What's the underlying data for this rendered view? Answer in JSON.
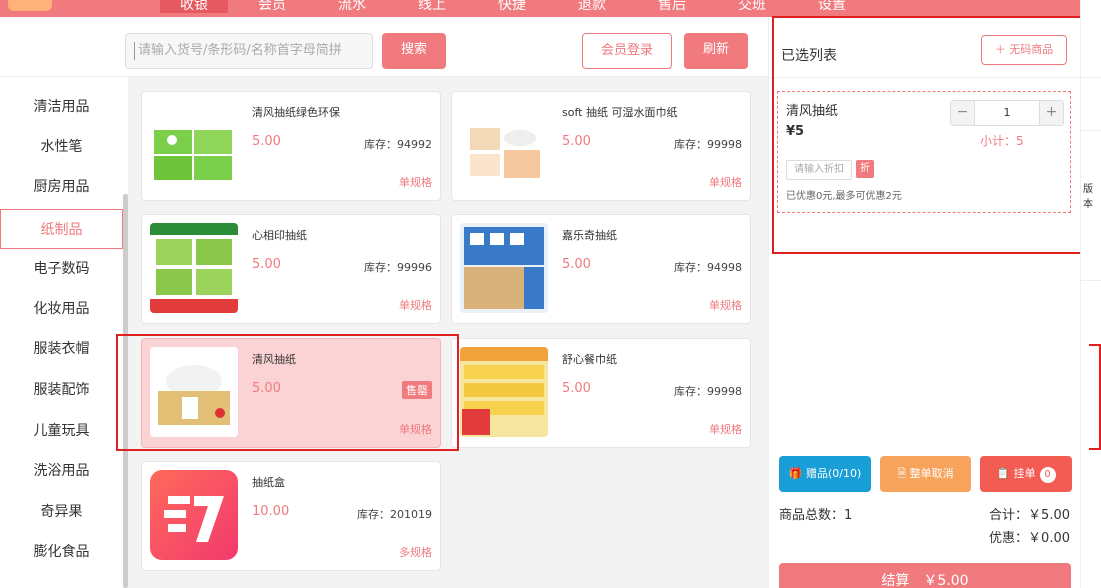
{
  "nav": {
    "tabs": [
      "收银",
      "会员",
      "流水",
      "线上",
      "快捷",
      "退款",
      "售后",
      "交班",
      "设置"
    ],
    "active_index": 0
  },
  "search": {
    "placeholder": "请输入货号/条形码/名称首字母简拼",
    "search_label": "搜索",
    "member_login_label": "会员登录",
    "refresh_label": "刷新"
  },
  "categories": [
    "清洁用品",
    "水性笔",
    "厨房用品",
    "纸制品",
    "电子数码",
    "化妆用品",
    "服装衣帽",
    "服装配饰",
    "儿童玩具",
    "洗浴用品",
    "奇异果",
    "膨化食品"
  ],
  "active_category_index": 3,
  "products": [
    {
      "name": "清风抽纸绿色环保",
      "price": "5.00",
      "stock": "库存：94992",
      "spec": "单规格"
    },
    {
      "name": "soft 抽纸 可湿水面巾纸",
      "price": "5.00",
      "stock": "库存：99998",
      "spec": "单规格"
    },
    {
      "name": "心相印抽纸",
      "price": "5.00",
      "stock": "库存：99996",
      "spec": "单规格"
    },
    {
      "name": "嘉乐奇抽纸",
      "price": "5.00",
      "stock": "库存：94998",
      "spec": "单规格"
    },
    {
      "name": "清风抽纸",
      "price": "5.00",
      "badge": "售罄",
      "spec": "单规格"
    },
    {
      "name": "舒心餐巾纸",
      "price": "5.00",
      "stock": "库存：99998",
      "spec": "单规格"
    },
    {
      "name": "抽纸盒",
      "price": "10.00",
      "stock": "库存：201019",
      "spec": "多规格"
    }
  ],
  "right": {
    "title": "已选列表",
    "no_code_label": "＋ 无码商品",
    "cart_item": {
      "name": "清风抽纸",
      "price": "¥5",
      "qty": "1",
      "subtotal": "小计：5",
      "discount_placeholder": "请输入折扣",
      "discount_badge": "折",
      "note": "已优惠0元,最多可优惠2元"
    },
    "gift_label": "赠品(0/10)",
    "cancel_label": "整单取消",
    "hang_label": "挂单",
    "hang_count": "0",
    "total_count": "商品总数：1",
    "total": "合计：￥5.00",
    "discount": "优惠：￥0.00",
    "checkout": "结算　￥5.00"
  },
  "strip": {
    "fragment": "版本"
  },
  "colors": {
    "accent": "#f07a7e",
    "highlight": "#e02020",
    "gift": "#1a9ed8",
    "cancel": "#f7a35c",
    "hang": "#f35c53"
  }
}
